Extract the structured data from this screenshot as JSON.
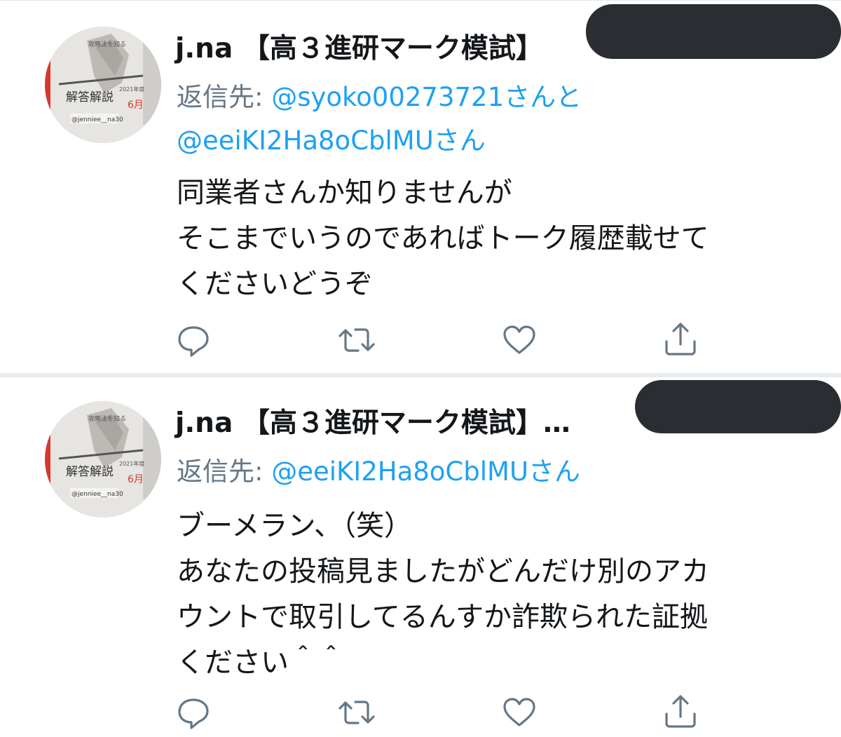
{
  "tweets": [
    {
      "display_name": "j.na 【高３進研マーク模試】",
      "reply_prefix": "返信先: ",
      "reply_line_1": "@syoko00273721さんと",
      "reply_line_2": "@eeiKI2Ha8oCblMUさん",
      "body_lines": [
        "同業者さんか知りませんが",
        "そこまでいうのであればトーク履歴載せて",
        "くださいどうぞ"
      ],
      "avatar": {
        "cover_text": "解答解説",
        "handle_tag": "@jenniee__na30",
        "side_text": "2021年度",
        "month": "6月",
        "small_text": "攻略法を知る"
      }
    },
    {
      "display_name": "j.na 【高３進研マーク模試】…",
      "reply_prefix": "返信先: ",
      "reply_line_1": "@eeiKI2Ha8oCblMUさん",
      "body_lines": [
        "ブーメラン、（笑）",
        "あなたの投稿見ましたがどんだけ別のアカ",
        "ウントで取引してるんすか詐欺られた証拠",
        "ください＾＾"
      ],
      "avatar": {
        "cover_text": "解答解説",
        "handle_tag": "@jenniee__na30",
        "side_text": "2021年度",
        "month": "6月",
        "small_text": "攻略法を知る"
      }
    }
  ],
  "icons": {
    "reply": "reply-icon",
    "retweet": "retweet-icon",
    "like": "heart-icon",
    "share": "share-icon"
  },
  "colors": {
    "mention": "#1da1f2",
    "meta": "#657786",
    "icon": "#657786",
    "redaction": "#2a2d31"
  }
}
